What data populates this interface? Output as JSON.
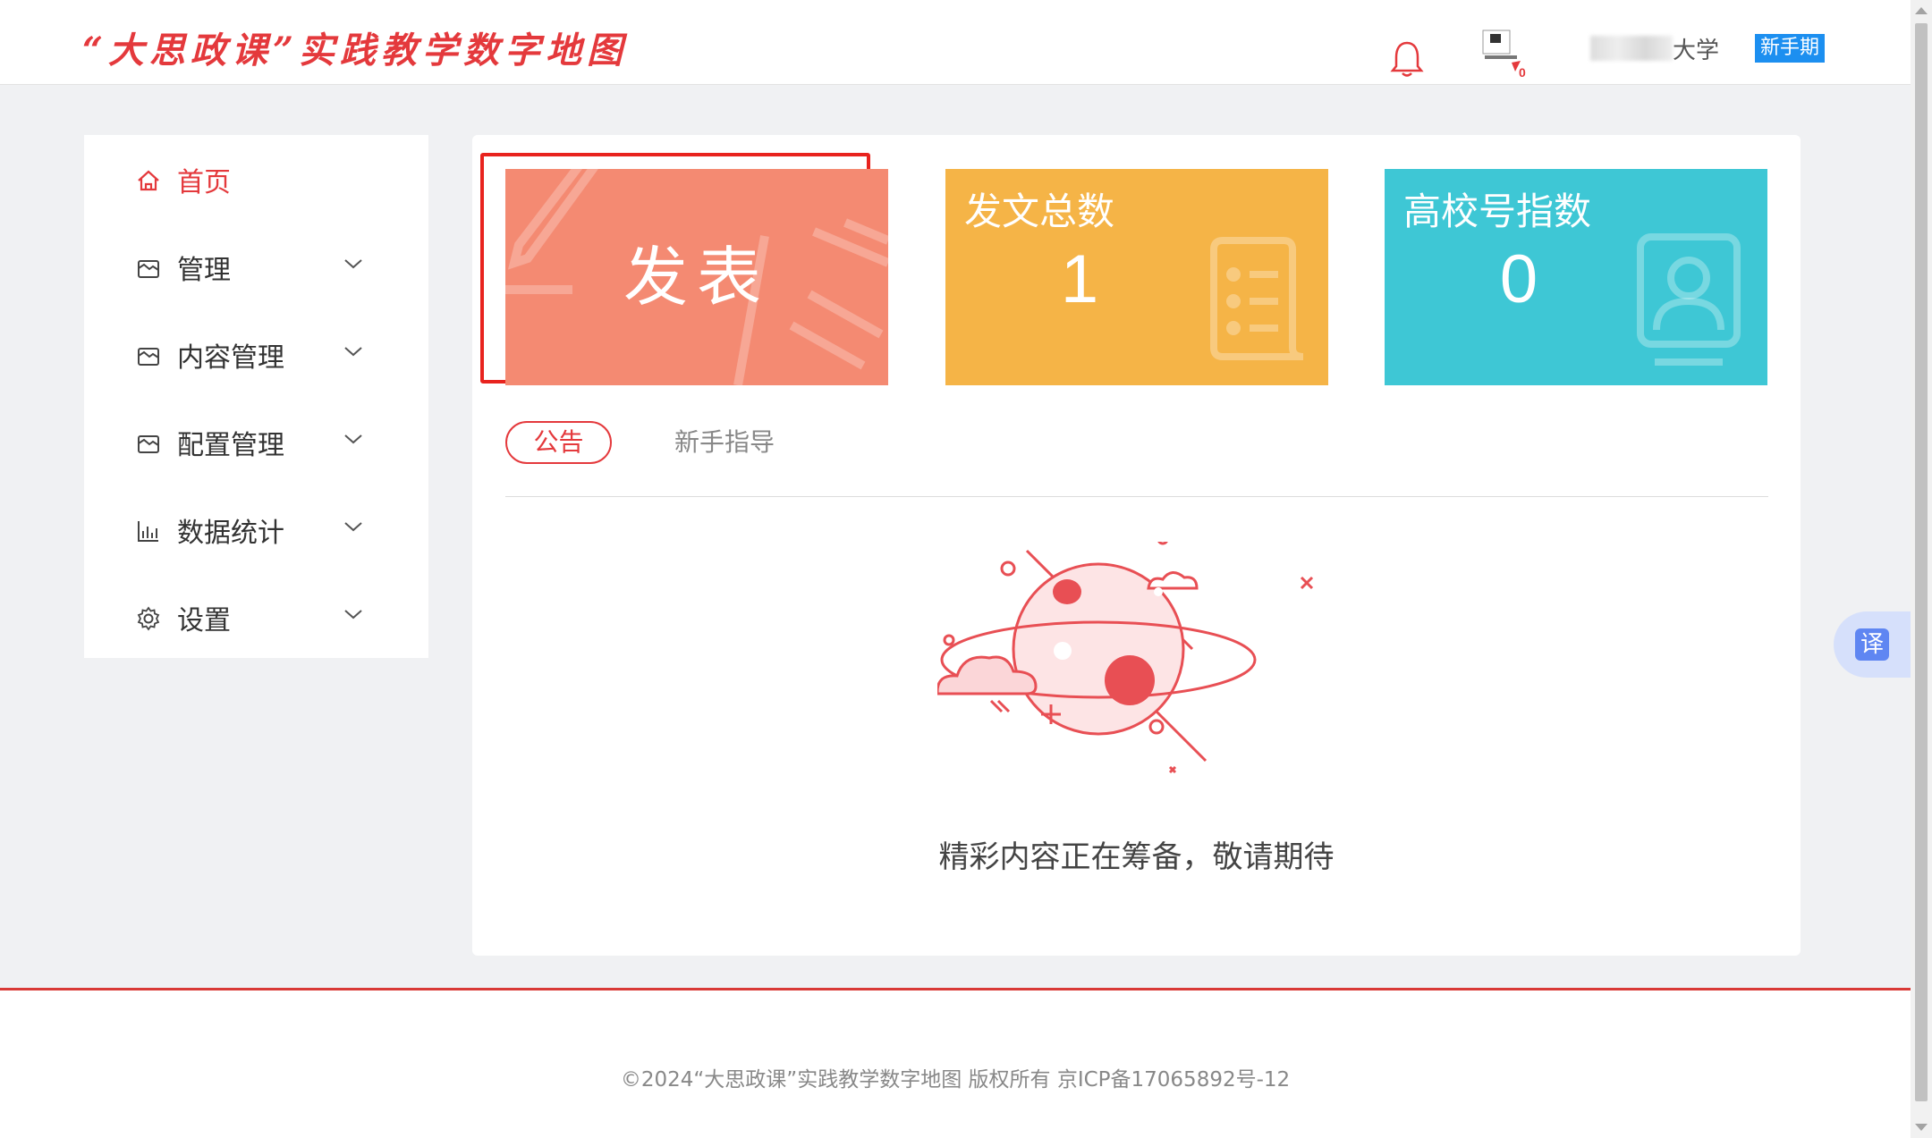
{
  "header": {
    "logo": "“大思政课”实践教学数字地图",
    "user_school": "大学",
    "newbie_badge": "新手期",
    "avatar_badge": "0"
  },
  "sidebar": {
    "items": [
      {
        "label": "首页",
        "icon": "home-icon",
        "active": true
      },
      {
        "label": "管理",
        "icon": "folder-icon",
        "expandable": true
      },
      {
        "label": "内容管理",
        "icon": "folder-icon",
        "expandable": true
      },
      {
        "label": "配置管理",
        "icon": "folder-icon",
        "expandable": true
      },
      {
        "label": "数据统计",
        "icon": "bar-chart-icon",
        "expandable": true
      },
      {
        "label": "设置",
        "icon": "gear-icon",
        "expandable": true
      }
    ]
  },
  "cards": {
    "publish": {
      "label": "发表",
      "color": "#f48a72"
    },
    "posts": {
      "title": "发文总数",
      "value": "1",
      "color": "#f5b447"
    },
    "index": {
      "title": "高校号指数",
      "value": "0",
      "color": "#3ec7d5"
    }
  },
  "tabs": {
    "notice": "公告",
    "guide": "新手指导"
  },
  "empty_state": {
    "message": "精彩内容正在筹备，敬请期待"
  },
  "footer": {
    "copyright": "©2024“大思政课”实践教学数字地图 版权所有 京ICP备17065892号-12"
  },
  "translate": {
    "label": "译"
  },
  "colors": {
    "brand_red": "#e4393c",
    "newbie_blue": "#1c8ff0"
  }
}
